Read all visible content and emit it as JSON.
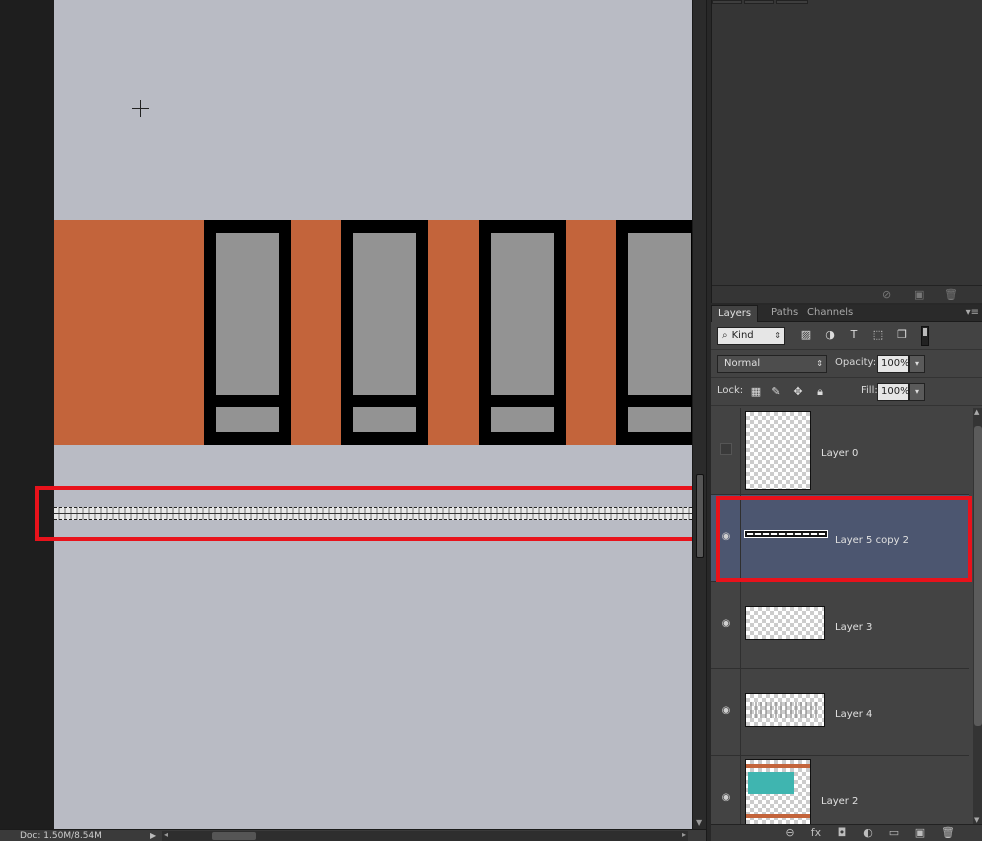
{
  "status_bar": {
    "doc_info": "Doc: 1.50M/8.54M"
  },
  "layers_panel": {
    "tabs": [
      {
        "label": "Layers",
        "active": true
      },
      {
        "label": "Paths",
        "active": false
      },
      {
        "label": "Channels",
        "active": false
      }
    ],
    "filter": {
      "kind_label": "Kind",
      "search_icon": "search-icon",
      "icons": [
        "image-filter-icon",
        "adjustment-filter-icon",
        "type-filter-icon",
        "shape-filter-icon",
        "smart-object-filter-icon"
      ]
    },
    "blend_mode": "Normal",
    "opacity_label": "Opacity:",
    "opacity_value": "100%",
    "lock_label": "Lock:",
    "lock_icons": [
      "lock-transparent-icon",
      "lock-image-icon",
      "lock-position-icon",
      "lock-all-icon"
    ],
    "fill_label": "Fill:",
    "fill_value": "100%",
    "layers": [
      {
        "name": "Layer 0",
        "visible": false,
        "selected": false
      },
      {
        "name": "Layer 5 copy 2",
        "visible": true,
        "selected": true
      },
      {
        "name": "Layer 3",
        "visible": true,
        "selected": false
      },
      {
        "name": "Layer 4",
        "visible": true,
        "selected": false
      },
      {
        "name": "Layer 2",
        "visible": true,
        "selected": false
      }
    ],
    "footer_icons": [
      "link-layers-icon",
      "fx-icon",
      "add-mask-icon",
      "adjustment-layer-icon",
      "new-group-icon",
      "new-layer-icon",
      "delete-layer-icon"
    ]
  },
  "colors": {
    "canvas_bg": "#b9bbc4",
    "band": "#c3643b",
    "window_glass": "#939393",
    "selected_layer": "#4c5670",
    "highlight": "#e8121b"
  }
}
